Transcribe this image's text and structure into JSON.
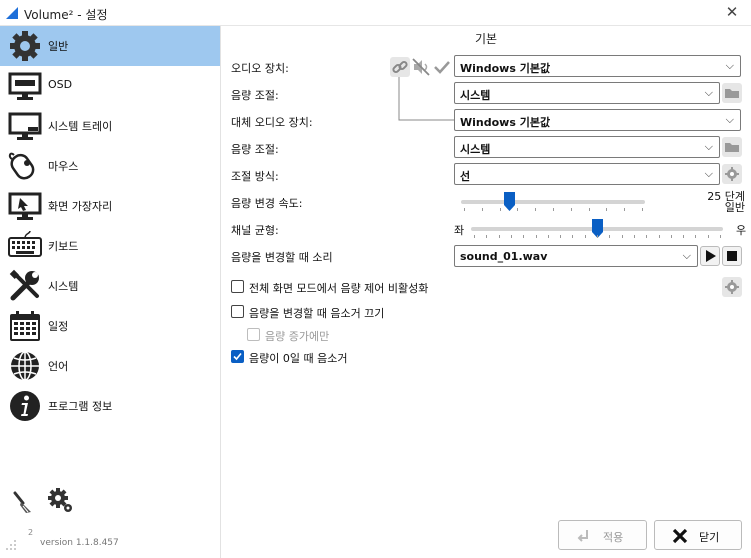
{
  "window": {
    "title": "Volume² - 설정"
  },
  "sidebar": {
    "items": [
      {
        "label": "일반",
        "icon": "gear-icon",
        "active": true
      },
      {
        "label": "OSD",
        "icon": "monitor-icon"
      },
      {
        "label": "시스템 트레이",
        "icon": "tray-icon"
      },
      {
        "label": "마우스",
        "icon": "mouse-icon"
      },
      {
        "label": "화면 가장자리",
        "icon": "screen-edge-icon"
      },
      {
        "label": "키보드",
        "icon": "keyboard-icon"
      },
      {
        "label": "시스템",
        "icon": "tools-icon"
      },
      {
        "label": "일정",
        "icon": "calendar-icon"
      },
      {
        "label": "언어",
        "icon": "globe-icon"
      },
      {
        "label": "프로그램 정보",
        "icon": "info-icon"
      }
    ],
    "version_number": "2",
    "version": "version 1.1.8.457"
  },
  "main": {
    "section_title": "기본",
    "audio_device_label": "오디오 장치:",
    "audio_device_value": "Windows 기본값",
    "volume_control_label_1": "음량 조절:",
    "volume_control_value_1": "시스템",
    "alt_audio_device_label": "대체 오디오 장치:",
    "alt_audio_device_value": "Windows 기본값",
    "volume_control_label_2": "음량 조절:",
    "volume_control_value_2": "시스템",
    "adjust_method_label": "조절 방식:",
    "adjust_method_value": "선",
    "change_speed_label": "음량 변경 속도:",
    "change_speed_value_line1": "25 단계",
    "change_speed_value_line2": "일반",
    "change_speed_fraction": 0.25,
    "channel_balance_label": "채널 균형:",
    "balance_left": "좌",
    "balance_right": "우",
    "channel_balance_fraction": 0.5,
    "change_sound_label": "음량을 변경할 때 소리",
    "change_sound_value": "sound_01.wav",
    "checkboxes": [
      {
        "label": "전체 화면 모드에서 음량 제어 비활성화",
        "checked": false,
        "enabled": true
      },
      {
        "label": "음량을 변경할 때 음소거 끄기",
        "checked": false,
        "enabled": true
      },
      {
        "label": "음량 증가에만",
        "checked": false,
        "enabled": false
      },
      {
        "label": "음량이 0일 때 음소거",
        "checked": true,
        "enabled": true
      }
    ]
  },
  "footer": {
    "apply_label": "적용",
    "close_label": "닫기"
  },
  "colors": {
    "active_nav": "#9ec8ef",
    "accent": "#0a5fc4"
  }
}
